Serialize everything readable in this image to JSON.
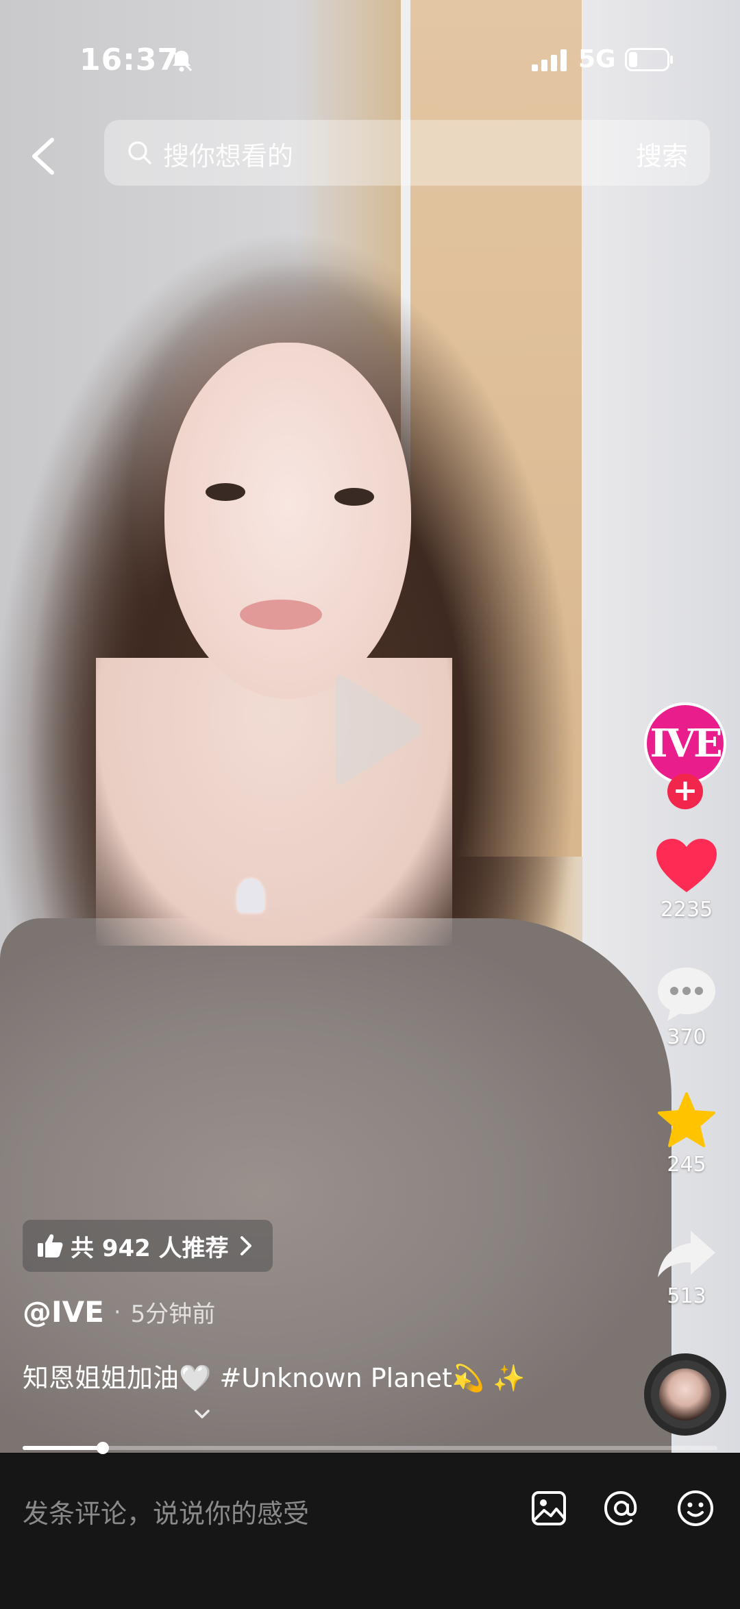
{
  "status": {
    "time": "16:37",
    "network": "5G",
    "icons": [
      "bell-off-icon",
      "signal-icon",
      "battery-icon"
    ]
  },
  "top_bar": {
    "search_placeholder": "搜你想看的",
    "search_button": "搜索"
  },
  "author": {
    "name": "@IVE",
    "avatar_text": "IVE",
    "post_time": "5分钟前",
    "separator": "·"
  },
  "actions": {
    "likes": "2235",
    "comments": "370",
    "favorites": "245",
    "shares": "513"
  },
  "recommend": {
    "label": "共 942 人推荐"
  },
  "caption": {
    "text": "知恩姐姐加油",
    "heart": "🤍",
    "hashtag": "#Unknown Planet",
    "emoji_1": "💫",
    "emoji_2": "✨"
  },
  "progress": {
    "fraction": 0.115
  },
  "comment_bar": {
    "placeholder": "发条评论，说说你的感受"
  },
  "colors": {
    "accent": "#f2264d",
    "avatar_bg": "#e91e8c",
    "like": "#fe2c55",
    "favorite": "#ffc300"
  }
}
